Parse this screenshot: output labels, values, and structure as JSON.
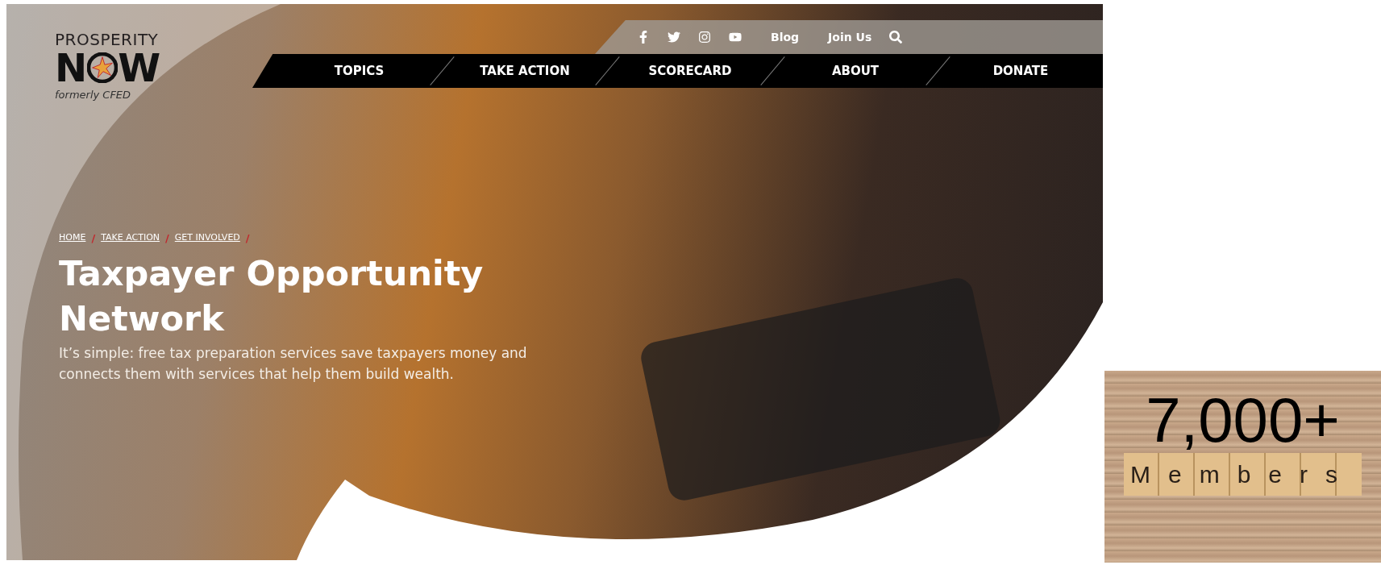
{
  "logo": {
    "line1": "PROSPERITY",
    "n": "N",
    "w": "W",
    "tagline": "formerly CFED"
  },
  "utility_nav": {
    "links": [
      "Blog",
      "Join Us"
    ]
  },
  "main_nav": [
    "TOPICS",
    "TAKE ACTION",
    "SCORECARD",
    "ABOUT",
    "DONATE"
  ],
  "breadcrumb": [
    "HOME",
    "TAKE ACTION",
    "GET INVOLVED"
  ],
  "breadcrumb_separator": "/",
  "hero": {
    "title": "Taxpayer Opportunity Network",
    "description": "It’s simple: free tax preparation services save taxpayers money and connects them with services that help them build wealth."
  },
  "stat": {
    "count": "7,000+",
    "label": "Members"
  }
}
